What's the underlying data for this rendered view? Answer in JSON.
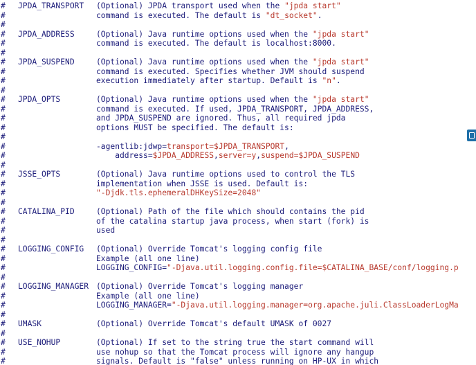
{
  "entries": [
    {
      "name": "JPDA_TRANSPORT",
      "lines": [
        [
          {
            "t": "(Optional) JPDA transport used when the "
          },
          {
            "t": "\"jpda start\"",
            "s": true
          }
        ],
        [
          {
            "t": "command is executed. The default is "
          },
          {
            "t": "\"dt_socket\"",
            "s": true
          },
          {
            "t": "."
          }
        ]
      ]
    },
    {
      "name": "JPDA_ADDRESS",
      "lines": [
        [
          {
            "t": "(Optional) Java runtime options used when the "
          },
          {
            "t": "\"jpda start\"",
            "s": true
          }
        ],
        [
          {
            "t": "command is executed. The default is localhost:8000."
          }
        ]
      ]
    },
    {
      "name": "JPDA_SUSPEND",
      "lines": [
        [
          {
            "t": "(Optional) Java runtime options used when the "
          },
          {
            "t": "\"jpda start\"",
            "s": true
          }
        ],
        [
          {
            "t": "command is executed. Specifies whether JVM should suspend"
          }
        ],
        [
          {
            "t": "execution immediately after startup. Default is "
          },
          {
            "t": "\"n\"",
            "s": true
          },
          {
            "t": "."
          }
        ]
      ]
    },
    {
      "name": "JPDA_OPTS",
      "lines": [
        [
          {
            "t": "(Optional) Java runtime options used when the "
          },
          {
            "t": "\"jpda start\"",
            "s": true
          }
        ],
        [
          {
            "t": "command is executed. If used, JPDA_TRANSPORT, JPDA_ADDRESS,"
          }
        ],
        [
          {
            "t": "and JPDA_SUSPEND are ignored. Thus, all required jpda"
          }
        ],
        [
          {
            "t": "options MUST be specified. The default is:"
          }
        ],
        [],
        [
          {
            "t": "-agentlib:jdwp="
          },
          {
            "t": "transport=$JPDA_TRANSPORT",
            "s": true
          },
          {
            "t": ","
          }
        ],
        [
          {
            "t": "    address="
          },
          {
            "t": "$JPDA_ADDRESS",
            "s": true
          },
          {
            "t": ","
          },
          {
            "t": "server=y",
            "s": true
          },
          {
            "t": ","
          },
          {
            "t": "suspend=$JPDA_SUSPEND",
            "s": true
          }
        ]
      ]
    },
    {
      "name": "JSSE_OPTS",
      "lines": [
        [
          {
            "t": "(Optional) Java runtime options used to control the TLS"
          }
        ],
        [
          {
            "t": "implementation when JSSE is used. Default is:"
          }
        ],
        [
          {
            "t": "\"-Djdk.tls.ephemeralDHKeySize=2048\"",
            "s": true
          }
        ]
      ]
    },
    {
      "name": "CATALINA_PID",
      "lines": [
        [
          {
            "t": "(Optional) Path of the file which should contains the pid"
          }
        ],
        [
          {
            "t": "of the catalina startup java process, when start (fork) is"
          }
        ],
        [
          {
            "t": "used"
          }
        ]
      ]
    },
    {
      "name": "LOGGING_CONFIG",
      "lines": [
        [
          {
            "t": "(Optional) Override Tomcat's logging config file"
          }
        ],
        [
          {
            "t": "Example (all one line)"
          }
        ],
        [
          {
            "t": "LOGGING_CONFIG="
          },
          {
            "t": "\"-Djava.util.logging.config.file=$CATALINA_BASE/conf/logging.p",
            "s": true
          }
        ]
      ]
    },
    {
      "name": "LOGGING_MANAGER",
      "lines": [
        [
          {
            "t": "(Optional) Override Tomcat's logging manager"
          }
        ],
        [
          {
            "t": "Example (all one line)"
          }
        ],
        [
          {
            "t": "LOGGING_MANAGER="
          },
          {
            "t": "\"-Djava.util.logging.manager=org.apache.juli.ClassLoaderLogMa",
            "s": true
          }
        ]
      ]
    },
    {
      "name": "UMASK",
      "lines": [
        [
          {
            "t": "(Optional) Override Tomcat's default UMASK of 0027"
          }
        ]
      ]
    },
    {
      "name": "USE_NOHUP",
      "lines": [
        [
          {
            "t": "(Optional) If set to the string true the start command will"
          }
        ],
        [
          {
            "t": "use nohup so that the Tomcat process will ignore any hangup"
          }
        ],
        [
          {
            "t": "signals. Default is \"false\" unless running on HP-UX in which"
          }
        ]
      ]
    }
  ],
  "layout_rows": [
    0,
    3,
    6,
    10,
    18,
    22,
    26,
    30,
    34,
    36
  ],
  "colors": {
    "text": "#1c1c7a",
    "string": "#b83a2e",
    "background": "#ffffff",
    "edge_widget": "#1e6fa8"
  },
  "edge_widget_icon": "window-icon"
}
